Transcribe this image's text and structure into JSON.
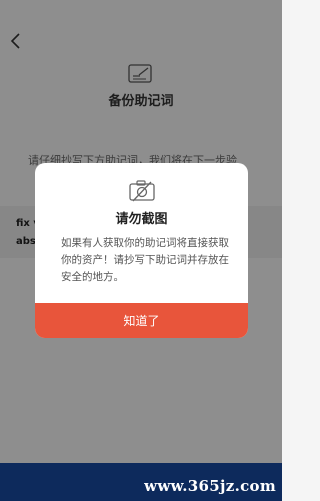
{
  "header": {
    "back_icon": "chevron-left-icon",
    "title": "备份助记词",
    "title_icon": "edit-note-icon"
  },
  "main": {
    "instruction": "请仔细抄写下方助记词，我们将在下一步验",
    "phrase_lines": [
      "fix v",
      "abs"
    ]
  },
  "dialog": {
    "icon": "no-screenshot-icon",
    "title": "请勿截图",
    "body_lines": [
      "如果有人获取你的助记词将直接获取",
      "你的资产！请抄写下助记词并存放在",
      "安全的地方。"
    ],
    "ok_label": "知道了"
  },
  "footer": {
    "watermark": "www.365jz.com"
  },
  "colors": {
    "accent": "#e8553b",
    "banner": "#0d2a5c",
    "background": "#f5f5f5"
  }
}
